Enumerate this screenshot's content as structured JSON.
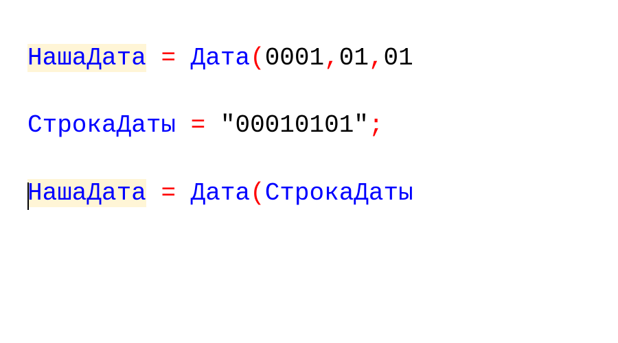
{
  "code": {
    "line1": {
      "var": "НашаДата",
      "op": "=",
      "func": "Дата",
      "paren_open": "(",
      "arg1": "0001",
      "comma1": ",",
      "arg2": "01",
      "comma2": ",",
      "arg3": "01"
    },
    "line2": {
      "var": "СтрокаДаты",
      "op": "=",
      "str": "\"00010101\"",
      "semi": ";"
    },
    "line3": {
      "var": "НашаДата",
      "op": "=",
      "func": "Дата",
      "paren_open": "(",
      "arg1": "СтрокаДаты"
    }
  }
}
